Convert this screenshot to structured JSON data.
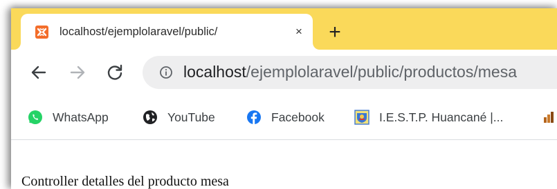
{
  "browser": {
    "tab": {
      "title": "localhost/ejemplolaravel/public/",
      "favicon": "xampp-icon",
      "close_symbol": "×"
    },
    "new_tab_symbol": "+",
    "address_bar": {
      "host": "localhost",
      "path": "/ejemplolaravel/public/productos/mesa"
    },
    "bookmarks": [
      {
        "label": "WhatsApp",
        "icon": "whatsapp-icon"
      },
      {
        "label": "YouTube",
        "icon": "globe-icon"
      },
      {
        "label": "Facebook",
        "icon": "facebook-icon"
      },
      {
        "label": "I.E.S.T.P. Huancané |...",
        "icon": "institute-logo-icon"
      }
    ]
  },
  "page": {
    "text": "Controller detalles del producto mesa"
  },
  "colors": {
    "tabstrip": "#fad95a",
    "favicon": "#f36d2a",
    "whatsapp": "#25d366",
    "facebook": "#1877f2"
  }
}
